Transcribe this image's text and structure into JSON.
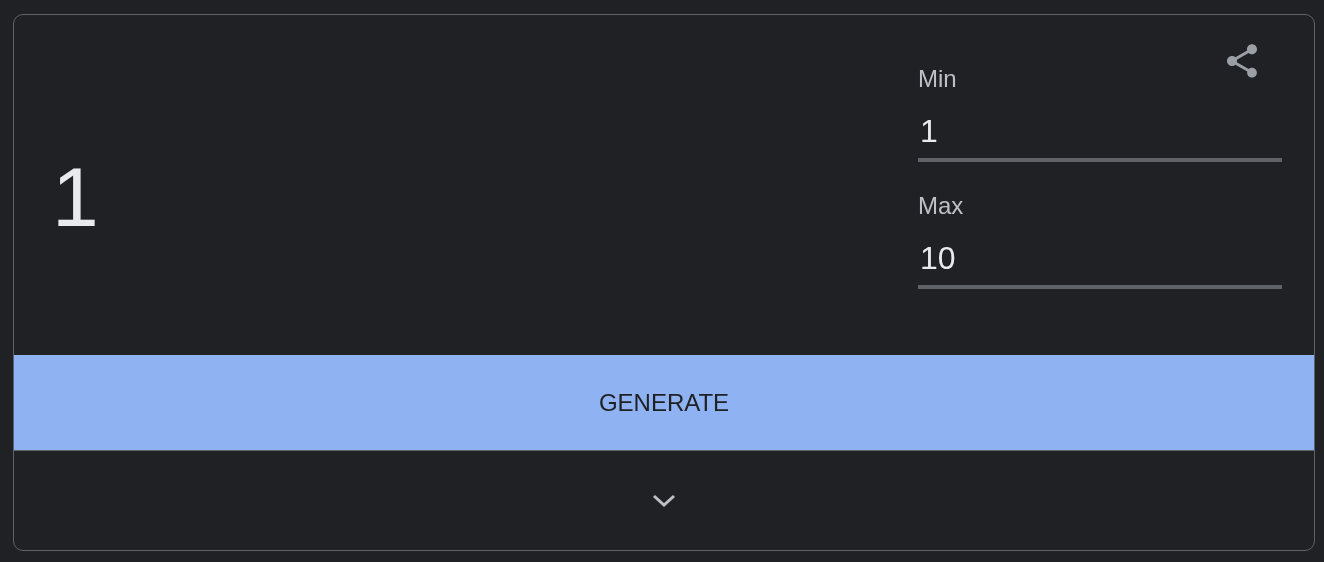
{
  "result": "1",
  "fields": [
    {
      "label": "Min",
      "value": "1"
    },
    {
      "label": "Max",
      "value": "10"
    }
  ],
  "button": "GENERATE"
}
